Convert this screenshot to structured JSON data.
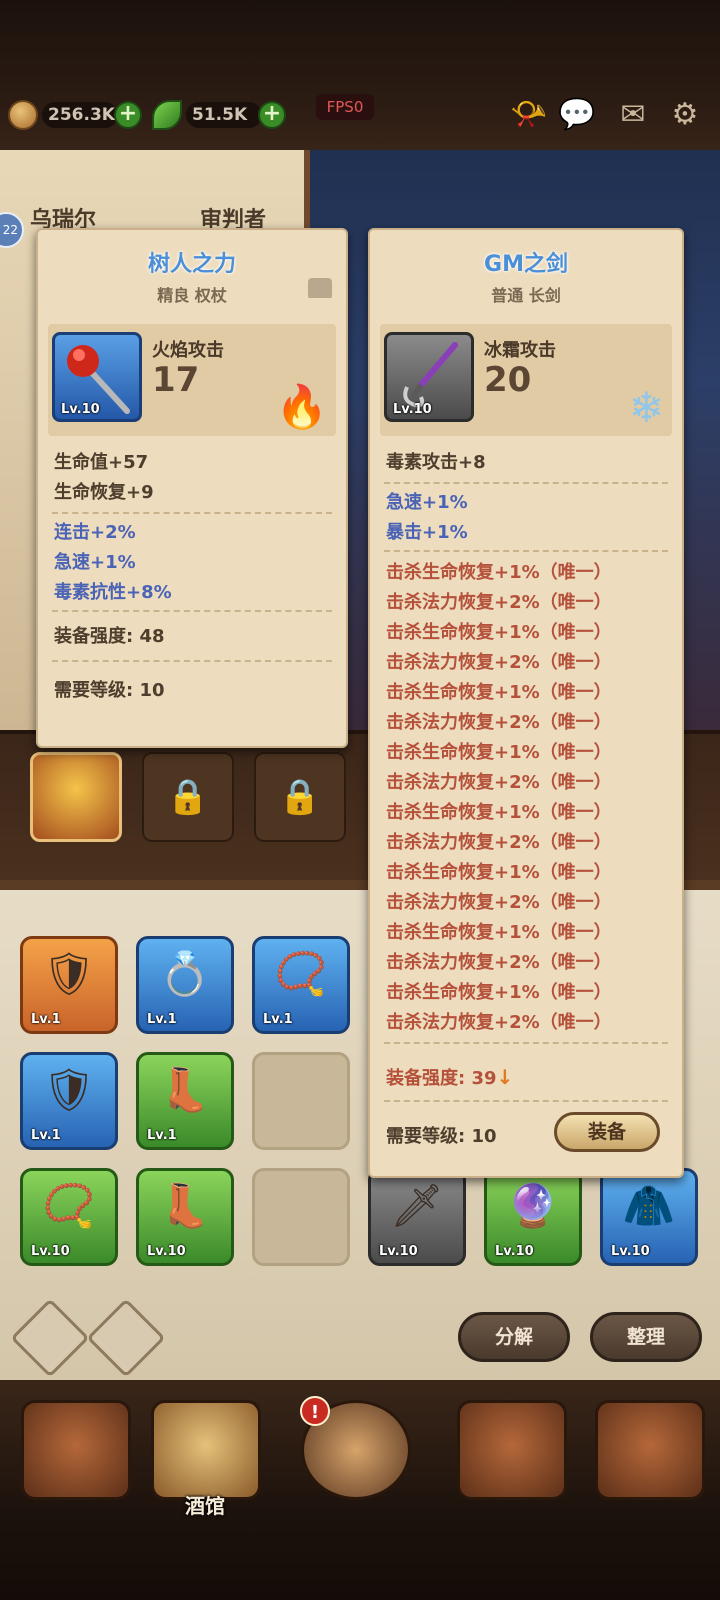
{
  "top_bar": {
    "gold": "256.3K",
    "wood": "51.5K",
    "fps": "FPS0",
    "icons": [
      "gold-coin-icon",
      "leaf-icon",
      "horn-icon",
      "chat-icon",
      "mail-icon",
      "gear-icon"
    ]
  },
  "background": {
    "left_panel_title_1": "乌瑞尔",
    "left_panel_title_2": "审判者",
    "level_badge": "22"
  },
  "card_left": {
    "title": "树人之力",
    "subtitle": "精良 权杖",
    "icon_level": "Lv.10",
    "attack_label": "火焰攻击",
    "attack_value": "17",
    "element_icon": "fire-icon",
    "base_stats": [
      "生命值+57",
      "生命恢复+9"
    ],
    "bonus_stats": [
      "连击+2%",
      "急速+1%",
      "毒素抗性+8%"
    ],
    "strength": "装备强度: 48",
    "required_level": "需要等级: 10"
  },
  "card_right": {
    "title": "GM之剑",
    "subtitle": "普通 长剑",
    "icon_level": "Lv.10",
    "attack_label": "冰霜攻击",
    "attack_value": "20",
    "element_icon": "snowflake-icon",
    "base_stats": [
      "毒素攻击+8"
    ],
    "bonus_stats": [
      "急速+1%",
      "暴击+1%"
    ],
    "unique_stats": [
      "击杀生命恢复+1%（唯一）",
      "击杀法力恢复+2%（唯一）",
      "击杀生命恢复+1%（唯一）",
      "击杀法力恢复+2%（唯一）",
      "击杀生命恢复+1%（唯一）",
      "击杀法力恢复+2%（唯一）",
      "击杀生命恢复+1%（唯一）",
      "击杀法力恢复+2%（唯一）",
      "击杀生命恢复+1%（唯一）",
      "击杀法力恢复+2%（唯一）",
      "击杀生命恢复+1%（唯一）",
      "击杀法力恢复+2%（唯一）",
      "击杀生命恢复+1%（唯一）",
      "击杀法力恢复+2%（唯一）",
      "击杀生命恢复+1%（唯一）",
      "击杀法力恢复+2%（唯一）"
    ],
    "strength_label": "装备强度: ",
    "strength_value": "39",
    "required_level": "需要等级: 10",
    "equip_button": "装备"
  },
  "inventory": {
    "row1_levels": [
      "Lv.1",
      "Lv.1",
      "Lv.1"
    ],
    "row2_levels": [
      "Lv.1",
      "Lv.1"
    ],
    "row3_levels": [
      "Lv.10",
      "Lv.10",
      "Lv.10",
      "Lv.10",
      "Lv.10"
    ],
    "decompose_button": "分解",
    "sort_button": "整理"
  },
  "bottom_nav": {
    "tavern_label": "酒馆",
    "alert": "!"
  },
  "colors": {
    "card_bg": "#eddcbd",
    "title_blue": "#4b8fd6",
    "stat_blue": "#4a63b6",
    "stat_red": "#b5513b"
  }
}
